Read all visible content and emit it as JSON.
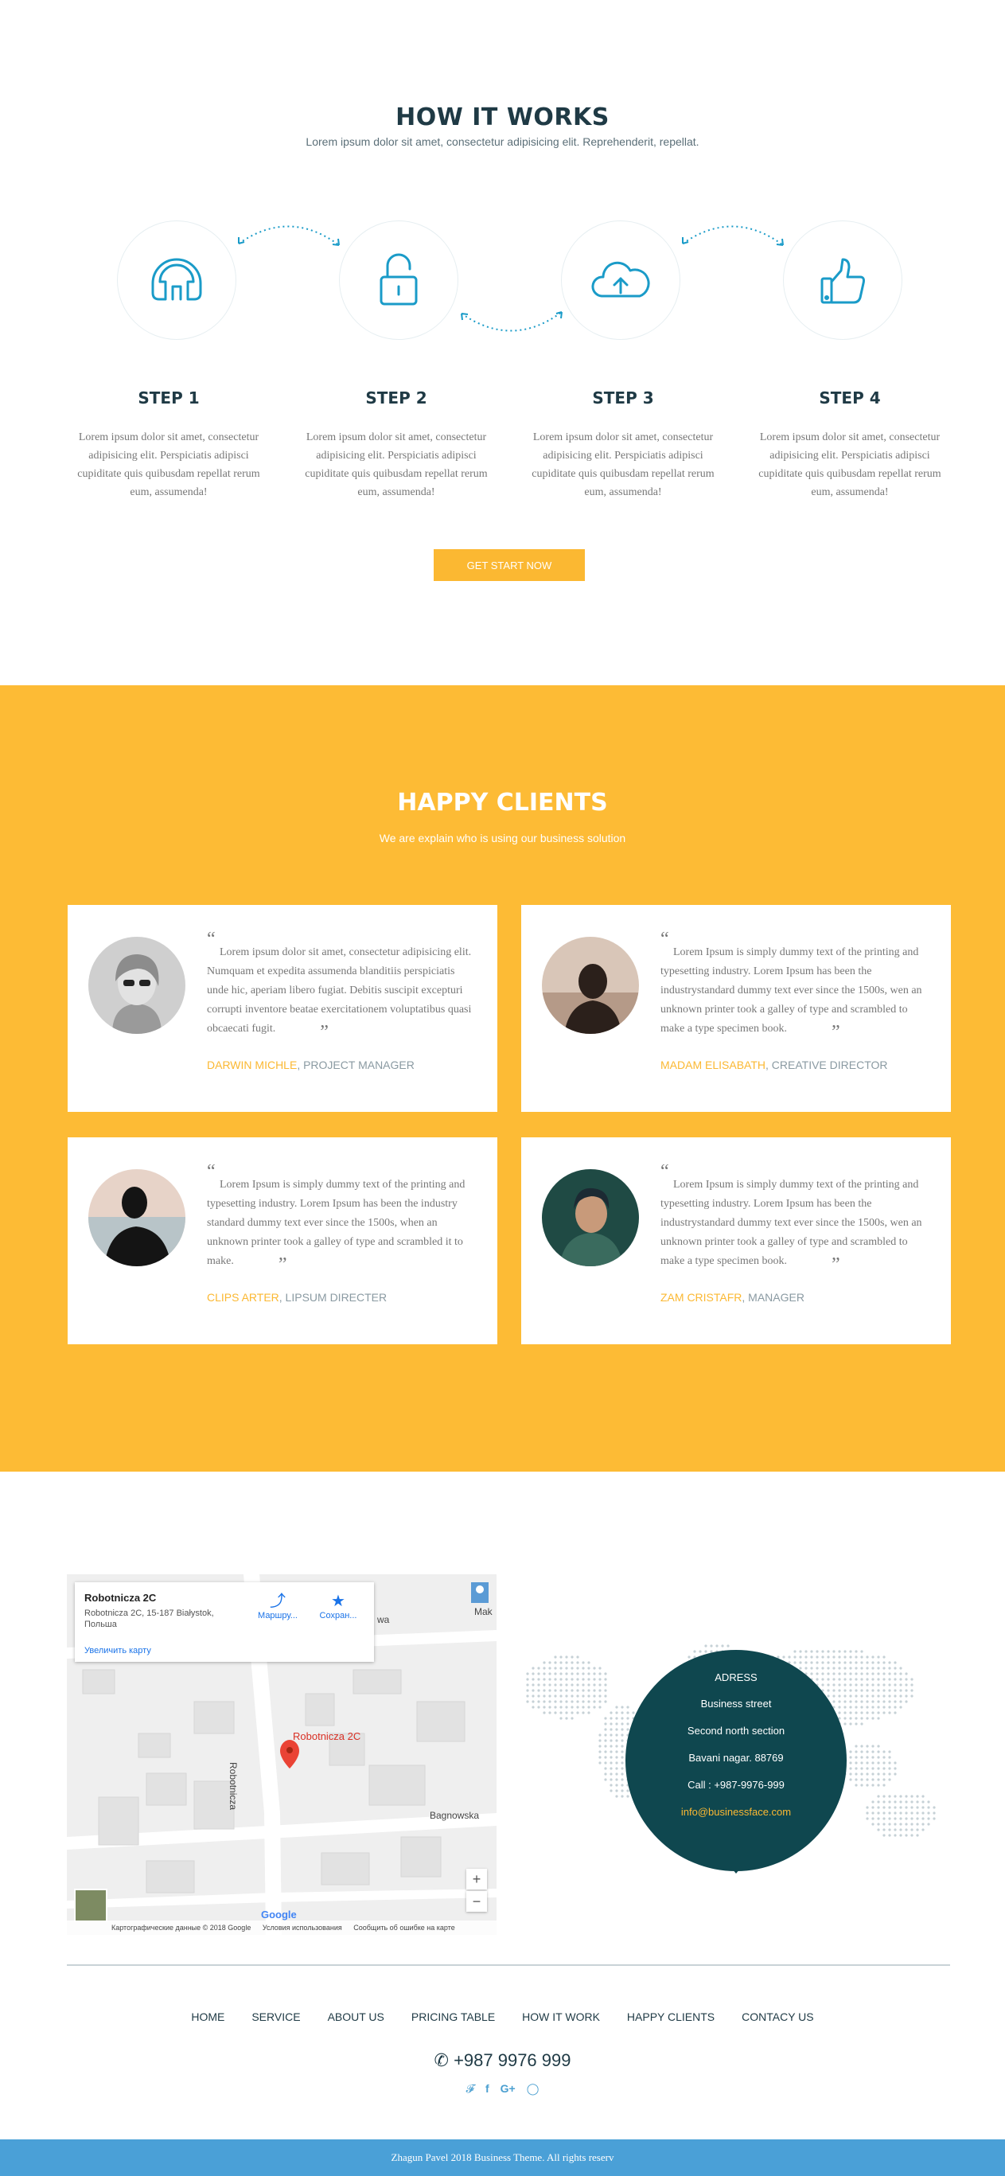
{
  "how_it_works": {
    "title": "HOW IT WORKS",
    "subtitle": "Lorem ipsum dolor sit amet, consectetur adipisicing elit. Reprehenderit, repellat.",
    "steps": [
      {
        "title": "STEP 1",
        "text": "Lorem ipsum dolor sit amet, consectetur adipisicing elit. Perspiciatis adipisci cupiditate quis quibusdam repellat rerum eum, assumenda!",
        "icon": "headset-icon"
      },
      {
        "title": "STEP 2",
        "text": "Lorem ipsum dolor sit amet, consectetur adipisicing elit. Perspiciatis adipisci cupiditate quis quibusdam repellat rerum eum, assumenda!",
        "icon": "unlock-icon"
      },
      {
        "title": "STEP 3",
        "text": "Lorem ipsum dolor sit amet, consectetur adipisicing elit. Perspiciatis adipisci cupiditate quis quibusdam repellat rerum eum, assumenda!",
        "icon": "cloud-upload-icon"
      },
      {
        "title": "STEP 4",
        "text": "Lorem ipsum dolor sit amet, consectetur adipisicing elit. Perspiciatis adipisci cupiditate quis quibusdam repellat rerum eum, assumenda!",
        "icon": "thumbs-up-icon"
      }
    ],
    "button_label": "GET START NOW"
  },
  "happy_clients": {
    "title": "HAPPY CLIENTS",
    "subtitle": "We are explain who is using our business solution",
    "testimonials": [
      {
        "quote": "Lorem ipsum dolor sit amet, consectetur adipisicing elit. Numquam et expedita assumenda blanditiis perspiciatis unde hic, aperiam libero fugiat. Debitis suscipit excepturi corrupti inventore beatae exercitationem voluptatibus quasi obcaecati fugit.",
        "name": "DARWIN MICHLE",
        "role": ", PROJECT MANAGER"
      },
      {
        "quote": "Lorem Ipsum is simply dummy text of the printing and typesetting industry. Lorem Ipsum has been the industrystandard dummy text ever since the 1500s, wen an unknown printer took a galley of type and scrambled to make a type specimen book.",
        "name": "MADAM ELISABATH",
        "role": ", CREATIVE DIRECTOR"
      },
      {
        "quote": "Lorem Ipsum is simply dummy text of the printing and typesetting industry. Lorem Ipsum has been the industry standard dummy text ever since the 1500s, when an unknown printer took a galley of type and scrambled it to make.",
        "name": "CLIPS ARTER",
        "role": ", LIPSUM DIRECTER"
      },
      {
        "quote": "Lorem Ipsum is simply dummy text of the printing and typesetting industry. Lorem Ipsum has been the industrystandard dummy text ever since the 1500s, wen an unknown printer took a galley of type and scrambled to make a type specimen book.",
        "name": "ZAM CRISTAFR",
        "role": ", MANAGER"
      }
    ],
    "quote_open": "“",
    "quote_close": "”"
  },
  "map": {
    "place_title": "Robotnicza 2C",
    "place_address": "Robotnicza 2C, 15-187 Białystok, Польша",
    "enlarge_link": "Увеличить карту",
    "route_label": "Маршру...",
    "save_label": "Сохран...",
    "pin_label": "Robotnicza 2C",
    "street_vertical": "Robotnicza",
    "street_bagnowska": "Bagnowska",
    "street_wa": "wa",
    "street_mak": "Mak",
    "zoom_in": "+",
    "zoom_out": "−",
    "google": "Google",
    "footer_data": "Картографические данные © 2018 Google",
    "footer_terms": "Условия использования",
    "footer_report": "Сообщить об ошибке на карте"
  },
  "address": {
    "heading": "ADRESS",
    "line1": "Business street",
    "line2": "Second north section",
    "line3": "Bavani nagar. 88769",
    "phone": "Call : +987-9976-999",
    "email": "info@businessface.com"
  },
  "footer": {
    "nav": [
      "HOME",
      "SERVICE",
      "ABOUT US",
      "PRICING TABLE",
      "HOW IT WORK",
      "HAPPY CLIENTS",
      "CONTACY US"
    ],
    "phone": "+987 9976 999",
    "social": [
      "twitter-icon",
      "facebook-icon",
      "google-plus-icon",
      "instagram-icon"
    ],
    "copyright": "Zhagun Pavel 2018 Business Theme. All rights reserv"
  },
  "colors": {
    "accent": "#fbb832",
    "clients_bg": "#fdbb35",
    "dark_teal": "#0f474f",
    "icon_blue": "#1a9bc8",
    "copyright_bg": "#4aa0d7"
  }
}
